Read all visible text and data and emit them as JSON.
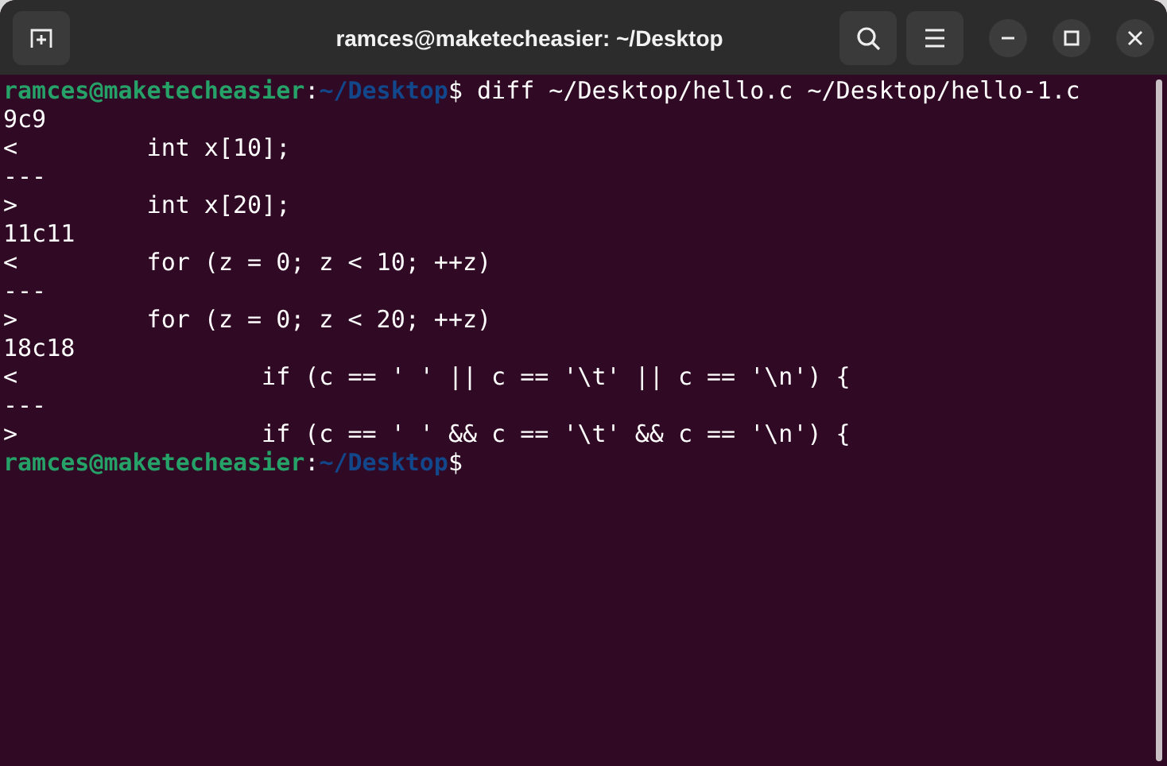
{
  "window": {
    "title": "ramces@maketecheasier: ~/Desktop"
  },
  "terminal": {
    "lines": [
      {
        "kind": "prompt",
        "user_host": "ramces@maketecheasier",
        "separator": ":",
        "path": "~/Desktop",
        "symbol": "$",
        "command": "diff ~/Desktop/hello.c ~/Desktop/hello-1.c"
      },
      {
        "kind": "output",
        "text": "9c9"
      },
      {
        "kind": "output",
        "text": "<         int x[10];"
      },
      {
        "kind": "output",
        "text": "---"
      },
      {
        "kind": "output",
        "text": ">         int x[20];"
      },
      {
        "kind": "output",
        "text": "11c11"
      },
      {
        "kind": "output",
        "text": "<         for (z = 0; z < 10; ++z)"
      },
      {
        "kind": "output",
        "text": "---"
      },
      {
        "kind": "output",
        "text": ">         for (z = 0; z < 20; ++z)"
      },
      {
        "kind": "output",
        "text": "18c18"
      },
      {
        "kind": "output",
        "text": "<                 if (c == ' ' || c == '\\t' || c == '\\n') {"
      },
      {
        "kind": "output",
        "text": "---"
      },
      {
        "kind": "output",
        "text": ">                 if (c == ' ' && c == '\\t' && c == '\\n') {"
      },
      {
        "kind": "prompt",
        "user_host": "ramces@maketecheasier",
        "separator": ":",
        "path": "~/Desktop",
        "symbol": "$"
      }
    ]
  }
}
